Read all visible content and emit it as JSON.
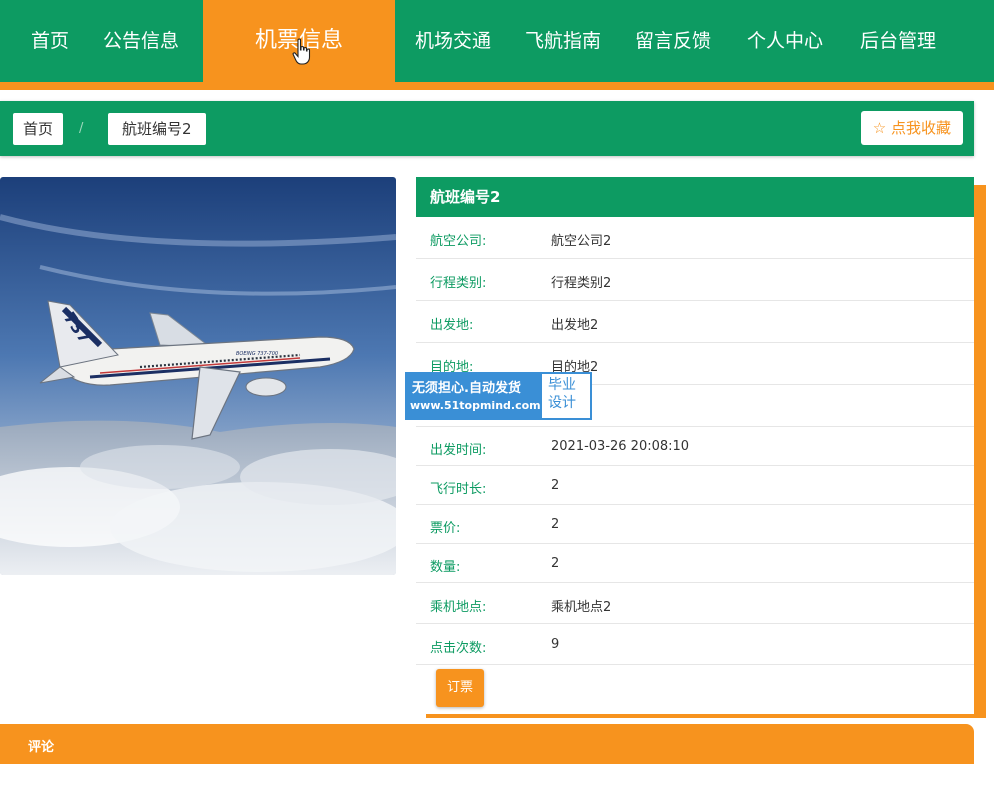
{
  "nav": {
    "items": [
      "首页",
      "公告信息",
      "机票信息",
      "机场交通",
      "飞航指南",
      "留言反馈",
      "个人中心",
      "后台管理"
    ],
    "active_index": 2
  },
  "breadcrumb": {
    "home": "首页",
    "separator": "/",
    "current": "航班编号2",
    "favorite_label": "☆ 点我收藏"
  },
  "picture": {
    "tail_text": "737",
    "fuselage_text": "BOEING 737-700"
  },
  "flight": {
    "title": "航班编号2",
    "fields": [
      {
        "label": "航空公司:",
        "value": "航空公司2"
      },
      {
        "label": "行程类别:",
        "value": "行程类别2"
      },
      {
        "label": "出发地:",
        "value": "出发地2"
      },
      {
        "label": "目的地:",
        "value": "目的地2"
      },
      {
        "label": "",
        "value": ""
      },
      {
        "label": "出发时间:",
        "value": "2021-03-26 20:08:10"
      },
      {
        "label": "飞行时长:",
        "value": "2"
      },
      {
        "label": "票价:",
        "value": "2"
      },
      {
        "label": "数量:",
        "value": "2"
      },
      {
        "label": "乘机地点:",
        "value": "乘机地点2"
      },
      {
        "label": "点击次数:",
        "value": "9"
      }
    ],
    "book_label": "订票"
  },
  "watermark": {
    "line1": "无须担心.自动发货",
    "line2": "www.51topmind.com",
    "side": "毕业设计"
  },
  "comments": {
    "label": "评论"
  },
  "colors": {
    "primary_green": "#0d9b62",
    "accent_orange": "#f7931e",
    "watermark_blue": "#3a8fd6"
  }
}
